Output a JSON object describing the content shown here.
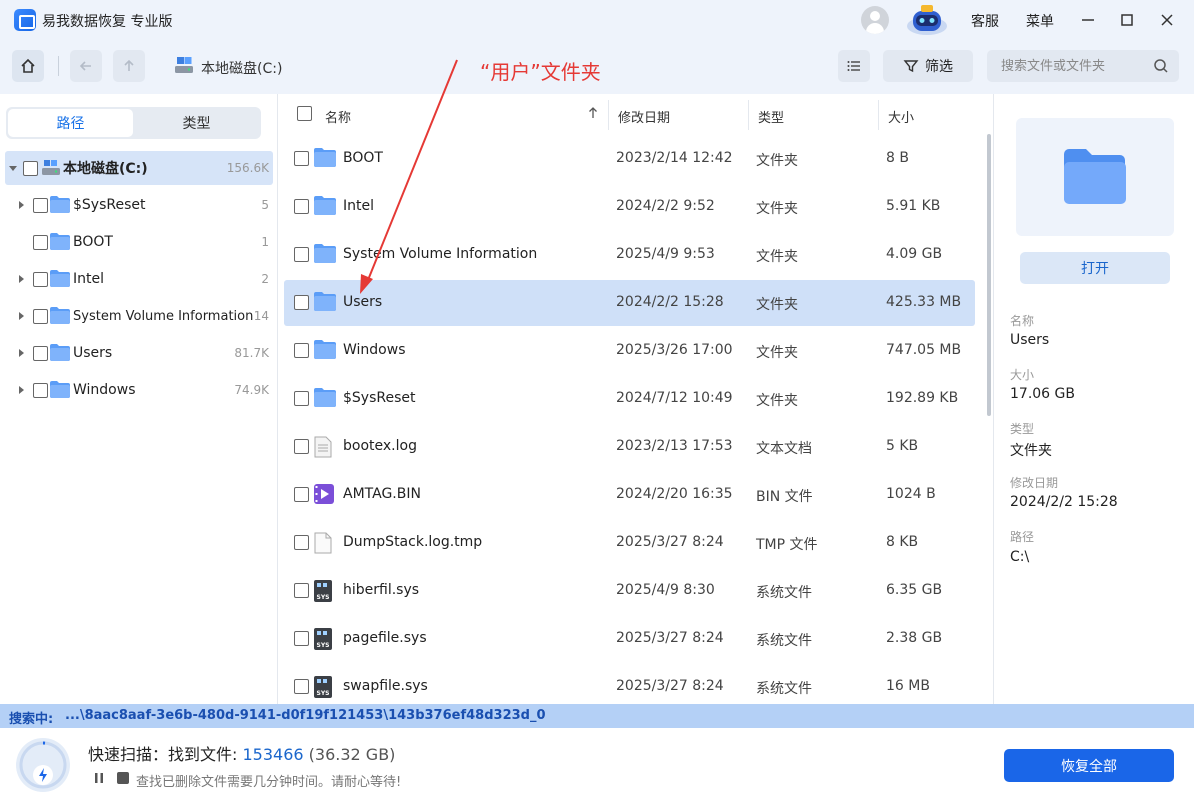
{
  "app": {
    "title": "易我数据恢复 专业版"
  },
  "titlebar": {
    "support_label": "客服",
    "menu_label": "菜单"
  },
  "toolbar": {
    "breadcrumb": "本地磁盘(C:)",
    "filter_label": "筛选",
    "search_placeholder": "搜索文件或文件夹"
  },
  "annotation": {
    "text": "“用户”文件夹",
    "color": "#e53935"
  },
  "left": {
    "tabs": [
      {
        "label": "路径"
      },
      {
        "label": "类型"
      }
    ],
    "tree": [
      {
        "label": "本地磁盘(C:)",
        "count": "156.6K"
      },
      {
        "label": "$SysReset",
        "count": "5"
      },
      {
        "label": "BOOT",
        "count": "1"
      },
      {
        "label": "Intel",
        "count": "2"
      },
      {
        "label": "System Volume Information",
        "count": "14"
      },
      {
        "label": "Users",
        "count": "81.7K"
      },
      {
        "label": "Windows",
        "count": "74.9K"
      }
    ]
  },
  "list": {
    "headers": {
      "name": "名称",
      "date": "修改日期",
      "type": "类型",
      "size": "大小"
    },
    "rows": [
      {
        "name": "BOOT",
        "date": "2023/2/14 12:42",
        "type": "文件夹",
        "size": "8 B",
        "icon": "folder-icon"
      },
      {
        "name": "Intel",
        "date": "2024/2/2 9:52",
        "type": "文件夹",
        "size": "5.91 KB",
        "icon": "folder-icon"
      },
      {
        "name": "System Volume Information",
        "date": "2025/4/9 9:53",
        "type": "文件夹",
        "size": "4.09 GB",
        "icon": "folder-icon"
      },
      {
        "name": "Users",
        "date": "2024/2/2 15:28",
        "type": "文件夹",
        "size": "425.33 MB",
        "icon": "folder-icon"
      },
      {
        "name": "Windows",
        "date": "2025/3/26 17:00",
        "type": "文件夹",
        "size": "747.05 MB",
        "icon": "folder-icon"
      },
      {
        "name": "$SysReset",
        "date": "2024/7/12 10:49",
        "type": "文件夹",
        "size": "192.89 KB",
        "icon": "folder-icon"
      },
      {
        "name": "bootex.log",
        "date": "2023/2/13 17:53",
        "type": "文本文档",
        "size": "5 KB",
        "icon": "text-file-icon"
      },
      {
        "name": "AMTAG.BIN",
        "date": "2024/2/20 16:35",
        "type": "BIN 文件",
        "size": "1024 B",
        "icon": "video-file-icon"
      },
      {
        "name": "DumpStack.log.tmp",
        "date": "2025/3/27 8:24",
        "type": "TMP 文件",
        "size": "8 KB",
        "icon": "blank-file-icon"
      },
      {
        "name": "hiberfil.sys",
        "date": "2025/4/9 8:30",
        "type": "系统文件",
        "size": "6.35 GB",
        "icon": "sys-file-icon"
      },
      {
        "name": "pagefile.sys",
        "date": "2025/3/27 8:24",
        "type": "系统文件",
        "size": "2.38 GB",
        "icon": "sys-file-icon"
      },
      {
        "name": "swapfile.sys",
        "date": "2025/3/27 8:24",
        "type": "系统文件",
        "size": "16 MB",
        "icon": "sys-file-icon"
      }
    ]
  },
  "details": {
    "open_label": "打开",
    "fields": [
      {
        "label": "名称",
        "value": "Users"
      },
      {
        "label": "大小",
        "value": "17.06 GB"
      },
      {
        "label": "类型",
        "value": "文件夹"
      },
      {
        "label": "修改日期",
        "value": "2024/2/2 15:28"
      },
      {
        "label": "路径",
        "value": "C:\\"
      }
    ]
  },
  "status": {
    "label": "搜索中:",
    "path": "...\\8aac8aaf-3e6b-480d-9141-d0f19f121453\\143b376ef48d323d_0"
  },
  "scan": {
    "title": "快速扫描：找到文件:",
    "count": "153466",
    "size": "(36.32 GB)",
    "hint": "查找已删除文件需要几分钟时间。请耐心等待!",
    "recover_all": "恢复全部"
  },
  "colors": {
    "accent": "#1a66e8",
    "selection": "#cfe0f8",
    "status_bar": "#b4d0f6",
    "annotation": "#e53935"
  }
}
